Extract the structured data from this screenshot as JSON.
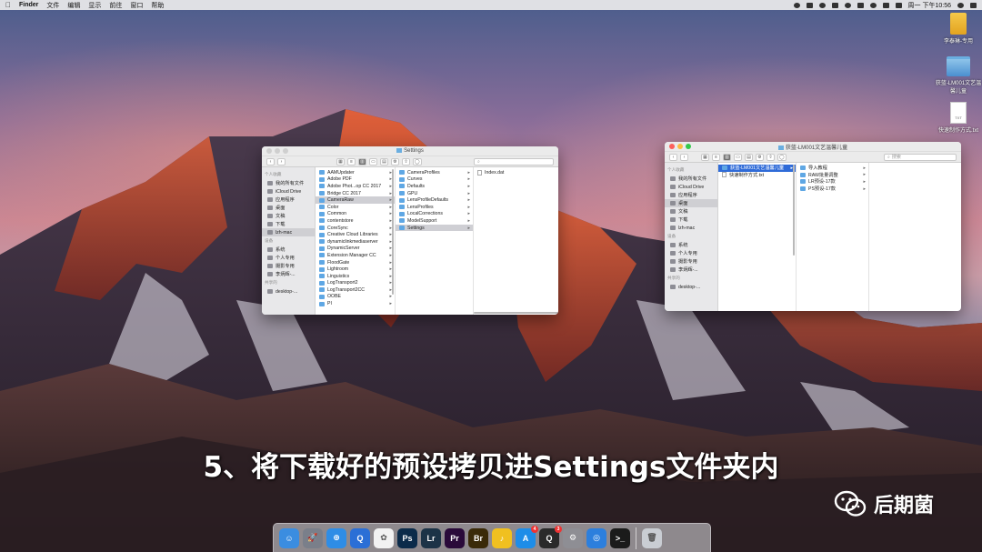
{
  "menubar": {
    "app": "Finder",
    "items": [
      "文件",
      "编辑",
      "显示",
      "前往",
      "窗口",
      "帮助"
    ],
    "clock": "周一 下午10:56"
  },
  "desktop_icons": [
    {
      "label": "李泰琳-专用",
      "kind": "folder-yellow"
    },
    {
      "label": "获蓝-LM001文艺温馨儿童",
      "kind": "folder-blue"
    },
    {
      "label": "快速制作方式.txt",
      "kind": "text-file",
      "badge": "TXT"
    }
  ],
  "finder_left": {
    "title": "Settings",
    "search_placeholder": "",
    "sidebar": {
      "sections": [
        {
          "head": "个人收藏",
          "items": [
            "我的所有文件",
            "iCloud Drive",
            "应用程序",
            "桌面",
            "文稿",
            "下载",
            "lzh-mac"
          ],
          "selected": 6
        },
        {
          "head": "设备",
          "items": [
            "系统",
            "个人专用",
            "摄影专用",
            "李炳辉-..."
          ]
        },
        {
          "head": "共享的",
          "items": [
            "desktop-..."
          ]
        }
      ]
    },
    "col1": [
      "AAMUpdater",
      "Adobe PDF",
      "Adobe Phot...op CC 2017",
      "Bridge CC 2017",
      "CameraRaw",
      "Color",
      "Common",
      "contentstore",
      "CoreSync",
      "Creative Cloud Libraries",
      "dynamiclinkmediaserver",
      "DynamicServer",
      "Extension Manager CC",
      "FloodGate",
      "Lightroom",
      "Linguistics",
      "LogTransport2",
      "LogTransport2CC",
      "OOBE",
      "PI"
    ],
    "col1_selected": 4,
    "col2": [
      "CameraProfiles",
      "Curves",
      "Defaults",
      "GPU",
      "LensProfileDefaults",
      "LensProfiles",
      "LocalCorrections",
      "ModelSupport",
      "Settings"
    ],
    "col2_selected": 8,
    "col3": [
      "Index.dat"
    ]
  },
  "finder_right": {
    "title": "获蓝-LM001文艺温馨儿童",
    "search_placeholder": "搜索",
    "sidebar": {
      "sections": [
        {
          "head": "个人收藏",
          "items": [
            "我的所有文件",
            "iCloud Drive",
            "应用程序",
            "桌面",
            "文稿",
            "下载",
            "lzh-mac"
          ],
          "selected": 3
        },
        {
          "head": "设备",
          "items": [
            "系统",
            "个人专用",
            "摄影专用",
            "李炳辉-..."
          ]
        },
        {
          "head": "共享的",
          "items": [
            "desktop-..."
          ]
        }
      ]
    },
    "col1": [
      "获蓝-LM001文艺温馨儿童",
      "快速制作方式.txt"
    ],
    "col1_selected": 0,
    "col2": [
      "导入教程",
      "RAW批量调整",
      "LR预设-17款",
      "PS预设-17款"
    ]
  },
  "caption": "5、将下载好的预设拷贝进Settings文件夹内",
  "watermark": "后期菌",
  "dock": {
    "apps": [
      {
        "name": "finder",
        "color": "#3b8de0",
        "text": "☺"
      },
      {
        "name": "launchpad",
        "color": "#7a7f8a",
        "text": "🚀"
      },
      {
        "name": "safari",
        "color": "#2e8de6",
        "text": "⊕"
      },
      {
        "name": "quicktime",
        "color": "#2b6fd6",
        "text": "Q"
      },
      {
        "name": "photos",
        "color": "#f2f2f2",
        "text": "✿"
      },
      {
        "name": "photoshop",
        "color": "#0b2b4a",
        "text": "Ps"
      },
      {
        "name": "lightroom",
        "color": "#1c3347",
        "text": "Lr"
      },
      {
        "name": "premiere",
        "color": "#2a0a3a",
        "text": "Pr"
      },
      {
        "name": "bridge",
        "color": "#3a2a08",
        "text": "Br"
      },
      {
        "name": "music",
        "color": "#f0c020",
        "text": "♪"
      },
      {
        "name": "app-store",
        "color": "#1e8de8",
        "text": "A",
        "badge": "4"
      },
      {
        "name": "qq",
        "color": "#2a2a2a",
        "text": "Q",
        "badge": "3"
      },
      {
        "name": "system-preferences",
        "color": "#8e8e94",
        "text": "⚙"
      },
      {
        "name": "browser",
        "color": "#2c7fdd",
        "text": "◎"
      },
      {
        "name": "terminal",
        "color": "#1b1b1b",
        "text": ">_"
      }
    ],
    "trash": {
      "name": "trash",
      "color": "#c9cdd3",
      "text": "🗑"
    }
  }
}
